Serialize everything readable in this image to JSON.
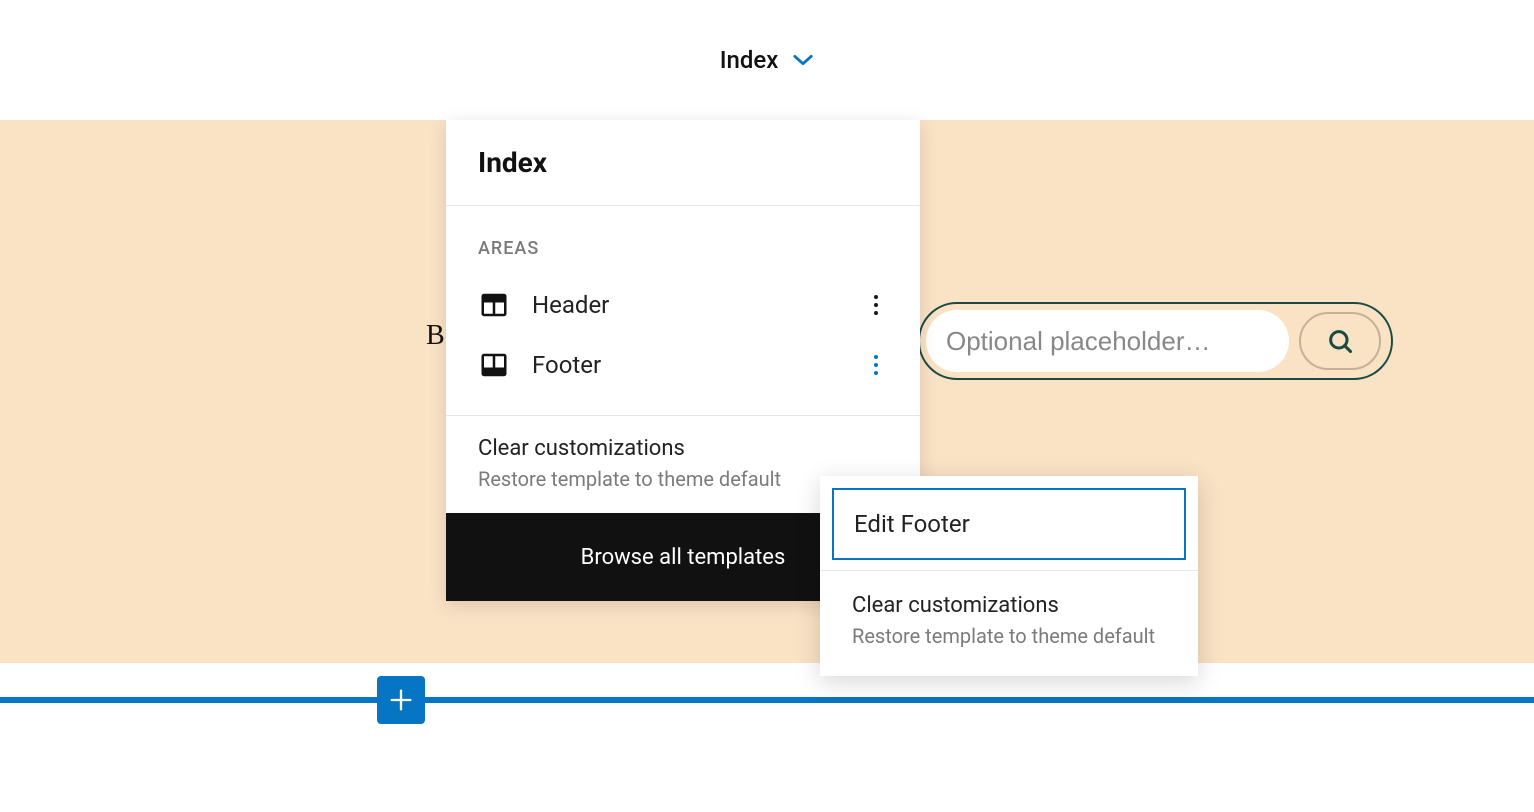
{
  "topbar": {
    "template_label": "Index"
  },
  "panel": {
    "title": "Index",
    "areas_label": "AREAS",
    "areas": [
      {
        "label": "Header"
      },
      {
        "label": "Footer"
      }
    ],
    "clear": {
      "title": "Clear customizations",
      "subtitle": "Restore template to theme default"
    },
    "browse_label": "Browse all templates"
  },
  "submenu": {
    "edit_label": "Edit Footer",
    "clear": {
      "title": "Clear customizations",
      "subtitle": "Restore template to theme default"
    }
  },
  "search": {
    "placeholder": "Optional placeholder…"
  }
}
